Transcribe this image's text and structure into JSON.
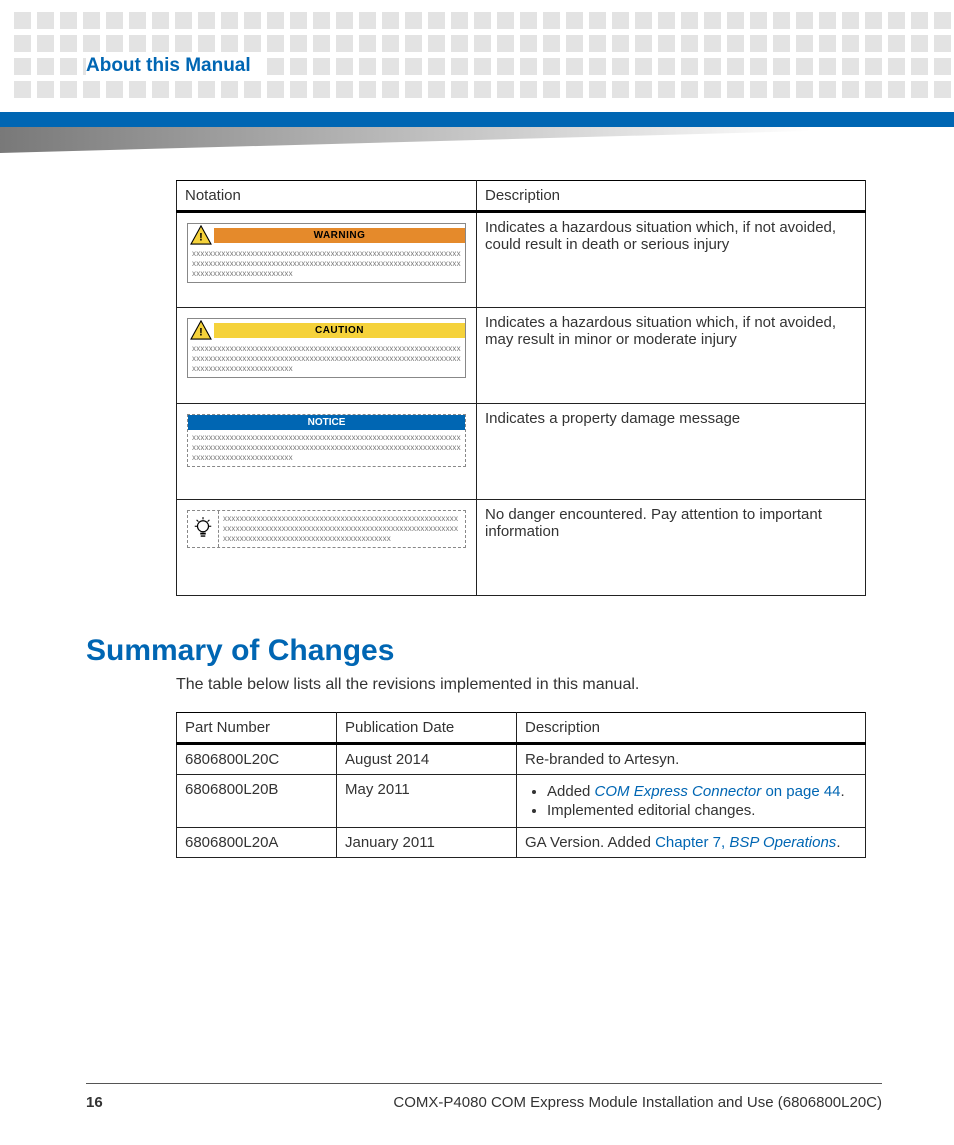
{
  "header": {
    "page_title": "About this Manual"
  },
  "notation_table": {
    "headers": [
      "Notation",
      "Description"
    ],
    "rows": [
      {
        "kind": "warning",
        "label": "WARNING",
        "description": "Indicates a hazardous situation which, if not avoided, could result in death or serious injury"
      },
      {
        "kind": "caution",
        "label": "CAUTION",
        "description": "Indicates a hazardous situation which, if not avoided, may result in minor or moderate injury"
      },
      {
        "kind": "notice",
        "label": "NOTICE",
        "description": "Indicates a property damage message"
      },
      {
        "kind": "info",
        "label": "",
        "description": "No danger encountered. Pay attention to important information"
      }
    ]
  },
  "summary": {
    "heading": "Summary of Changes",
    "intro": "The table below lists all the revisions implemented in this manual."
  },
  "changes_table": {
    "headers": [
      "Part Number",
      "Publication Date",
      "Description"
    ],
    "rows": [
      {
        "part": "6806800L20C",
        "date": "August 2014",
        "desc_plain": "Re-branded to Artesyn."
      },
      {
        "part": "6806800L20B",
        "date": "May 2011",
        "bullets": [
          {
            "prefix": "Added ",
            "link_ital": "COM Express Connector",
            "link_plain": " on page 44",
            "suffix": "."
          },
          {
            "prefix": "Implemented editorial changes.",
            "link_ital": "",
            "link_plain": "",
            "suffix": ""
          }
        ]
      },
      {
        "part": "6806800L20A",
        "date": "January 2011",
        "desc_prefix": "GA Version. Added ",
        "link_plain": "Chapter 7, ",
        "link_ital": "BSP Operations",
        "desc_suffix": "."
      }
    ]
  },
  "footer": {
    "page_number": "16",
    "doc_title": "COMX-P4080 COM Express Module Installation and Use (6806800L20C)"
  },
  "filler": "xxxxxxxxxxxxxxxxxxxxxxxxxxxxxxxxxxxxxxxxxxxxxxxxxxxxxxxxxxxxxxxxxxxxxxxxxxxxxxxxxxxxxxxxxxxxxxxxxxxxxxxxxxxxxxxxxxxxxxxxxxxxxxxxxxxxxxxxxxxxxxxxxxxxxxxx"
}
